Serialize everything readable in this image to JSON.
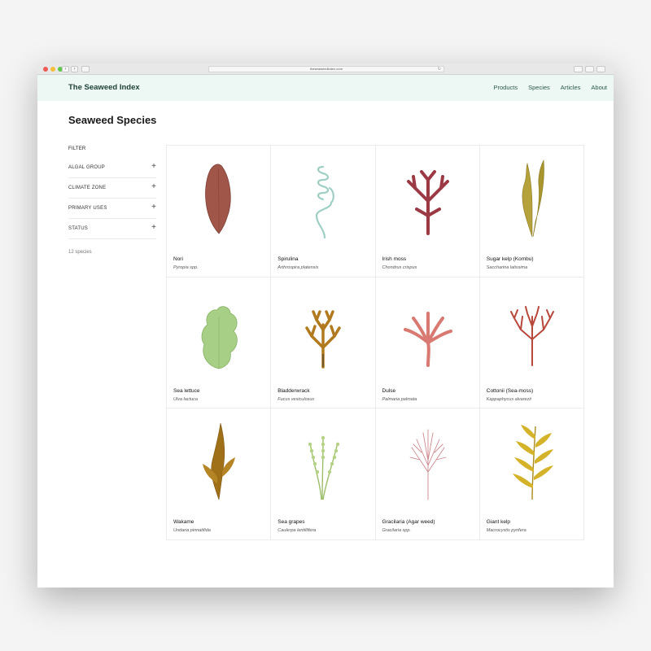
{
  "browser": {
    "url": "theseaweedindex.com"
  },
  "site": {
    "logo": "The Seaweed Index",
    "nav": [
      "Products",
      "Species",
      "Articles",
      "About"
    ]
  },
  "page": {
    "title": "Seaweed Species"
  },
  "filter": {
    "title": "FILTER",
    "groups": [
      "ALGAL GROUP",
      "CLIMATE ZONE",
      "PRIMARY USES",
      "STATUS"
    ],
    "count": "12 species"
  },
  "species": [
    {
      "name": "Nori",
      "scientific": "Pyropia spp.",
      "icon": "nori-leaf-icon",
      "color": "#a0574a"
    },
    {
      "name": "Spirulina",
      "scientific": "Arthrospira platensis",
      "icon": "spirulina-spiral-icon",
      "color": "#9fcfc4"
    },
    {
      "name": "Irish moss",
      "scientific": "Chondrus crispus",
      "icon": "irish-moss-icon",
      "color": "#9b3a44"
    },
    {
      "name": "Sugar kelp (Kombu)",
      "scientific": "Saccharina latissima",
      "icon": "sugar-kelp-icon",
      "color": "#b5a23a"
    },
    {
      "name": "Sea lettuce",
      "scientific": "Ulva lactuca",
      "icon": "sea-lettuce-icon",
      "color": "#a7cf85"
    },
    {
      "name": "Bladderwrack",
      "scientific": "Fucus vesiculosus",
      "icon": "bladderwrack-icon",
      "color": "#b27a1f"
    },
    {
      "name": "Dulse",
      "scientific": "Palmaria palmata",
      "icon": "dulse-icon",
      "color": "#d87a72"
    },
    {
      "name": "Cottonii (Sea-moss)",
      "scientific": "Kappaphycus alvarezii",
      "icon": "cottonii-icon",
      "color": "#b8473c"
    },
    {
      "name": "Wakame",
      "scientific": "Undaria pinnatifida",
      "icon": "wakame-icon",
      "color": "#a07019"
    },
    {
      "name": "Sea grapes",
      "scientific": "Caulerpa lentillifera",
      "icon": "sea-grapes-icon",
      "color": "#9dbd6a"
    },
    {
      "name": "Gracilaria (Agar weed)",
      "scientific": "Gracilaria spp.",
      "icon": "gracilaria-icon",
      "color": "#cc8a8e"
    },
    {
      "name": "Giant kelp",
      "scientific": "Macrocystis pyrifera",
      "icon": "giant-kelp-icon",
      "color": "#d4b22a"
    }
  ]
}
